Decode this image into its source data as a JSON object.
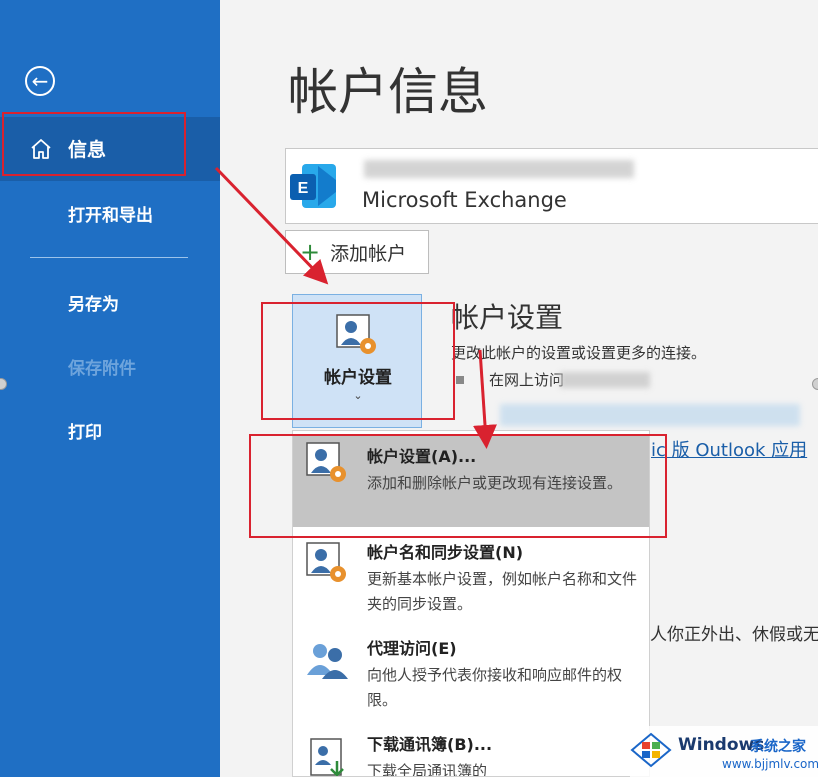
{
  "sidebar": {
    "items": [
      {
        "label": "信息"
      },
      {
        "label": "打开和导出"
      },
      {
        "label": "另存为"
      },
      {
        "label": "保存附件"
      },
      {
        "label": "打印"
      }
    ]
  },
  "main": {
    "title": "帐户信息",
    "account": {
      "type": "Microsoft Exchange"
    },
    "add_account_label": "添加帐户",
    "settings_button_label": "帐户设置",
    "settings_section": {
      "title": "帐户设置",
      "description": "更改此帐户的设置或设置更多的连接。",
      "web_access_text": "在网上访问",
      "outlook_link_text": "ic 版 Outlook 应用"
    },
    "out_of_office_text": "人你正外出、休假或无"
  },
  "dropdown": {
    "items": [
      {
        "title": "帐户设置(A)...",
        "description": "添加和删除帐户或更改现有连接设置。"
      },
      {
        "title": "帐户名和同步设置(N)",
        "description": "更新基本帐户设置，例如帐户名称和文件夹的同步设置。"
      },
      {
        "title": "代理访问(E)",
        "description": "向他人授予代表你接收和响应邮件的权限。"
      },
      {
        "title": "下载通讯簿(B)...",
        "description": "下载全局通讯簿的"
      }
    ]
  },
  "watermark": {
    "brand": "Windows",
    "brand_cn": "系统之家",
    "url": "www.bjjmlv.com"
  },
  "colors": {
    "sidebar": "#1f6fc4",
    "sidebar_selected": "#1a5ea8",
    "annotation_red": "#d9222f"
  }
}
